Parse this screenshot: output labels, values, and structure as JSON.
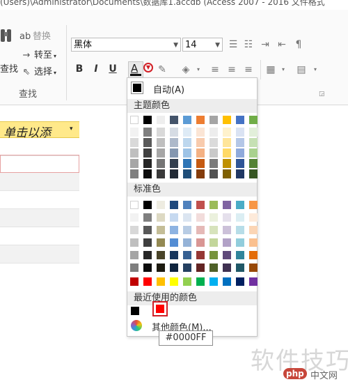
{
  "title_bar": {
    "text": "(Users)\\Administrator\\Documents\\数据库1.accdb (Access 2007 - 2016 文件格式"
  },
  "ribbon": {
    "find_group": {
      "find_label": "查找",
      "replace_label": "替换",
      "goto_label": "转至",
      "select_label": "选择",
      "group_label": "查找"
    },
    "text_format": {
      "font_name": "黑体",
      "font_size": "14",
      "bold": "B",
      "italic": "I",
      "underline": "U",
      "font_color_glyph": "A"
    }
  },
  "datasheet": {
    "column_header": "单击以添",
    "header_arrow": "▾"
  },
  "color_menu": {
    "automatic_label": "自动(A)",
    "theme_colors_label": "主题颜色",
    "standard_colors_label": "标准色",
    "recent_colors_label": "最近使用的颜色",
    "more_colors_label": "其他颜色(M)...",
    "tooltip_value": "#0000FF",
    "theme_base": [
      "#ffffff",
      "#000000",
      "#eeece1",
      "#1f497d",
      "#4f81bd",
      "#c0504d",
      "#f79646",
      "#9bbb59",
      "#4bacc6",
      "#8064a2"
    ],
    "theme_top": [
      "#ffffff",
      "#000000",
      "#eeeeee",
      "#44546a",
      "#5b9bd5",
      "#ed7d31",
      "#a5a5a5",
      "#ffc000",
      "#4472c4",
      "#70ad47"
    ],
    "theme_tints": [
      [
        "#f2f2f2",
        "#7f7f7f",
        "#d9d9d9",
        "#d6dce4",
        "#deebf6",
        "#fbe5d5",
        "#ededed",
        "#fff2cc",
        "#dae3f3",
        "#e2efda"
      ],
      [
        "#d9d9d9",
        "#595959",
        "#bfbfbf",
        "#adb9ca",
        "#bdd7ee",
        "#f8cbad",
        "#dbdbdb",
        "#ffe599",
        "#b4c7e7",
        "#c6e0b4"
      ],
      [
        "#bfbfbf",
        "#404040",
        "#a6a6a6",
        "#8497b0",
        "#9dc3e6",
        "#f4b183",
        "#c9c9c9",
        "#ffd966",
        "#8faadc",
        "#a9d18e"
      ],
      [
        "#a6a6a6",
        "#262626",
        "#757575",
        "#333f4f",
        "#2e75b6",
        "#c55a11",
        "#7b7b7b",
        "#bf9000",
        "#2f5597",
        "#548235"
      ],
      [
        "#7f7f7f",
        "#0d0d0d",
        "#3a3a3a",
        "#222a35",
        "#1f4e79",
        "#843c0c",
        "#525252",
        "#7f6000",
        "#203864",
        "#375623"
      ]
    ],
    "standard_top": [
      "#ffffff",
      "#000000",
      "#eeece1",
      "#1f497d",
      "#4f81bd",
      "#c0504d",
      "#9bbb59",
      "#8064a2",
      "#4bacc6",
      "#f79646"
    ],
    "standard_tints": [
      [
        "#f2f2f2",
        "#7f7f7f",
        "#ddd9c3",
        "#c6d9f0",
        "#dbe5f1",
        "#f2dcdb",
        "#ebf1dd",
        "#e5e0ec",
        "#dbeef3",
        "#fdeada"
      ],
      [
        "#d8d8d8",
        "#595959",
        "#c4bd97",
        "#8db3e2",
        "#b8cce4",
        "#e5b9b7",
        "#d7e3bc",
        "#ccc1d9",
        "#b7dde8",
        "#fbd5b5"
      ],
      [
        "#bfbfbf",
        "#3f3f3f",
        "#938953",
        "#548dd4",
        "#95b3d7",
        "#d99694",
        "#c3d69b",
        "#b2a2c7",
        "#92cddc",
        "#fac08f"
      ],
      [
        "#a5a5a5",
        "#262626",
        "#494429",
        "#17365d",
        "#366092",
        "#953734",
        "#76923c",
        "#5f497a",
        "#31859b",
        "#e36c09"
      ],
      [
        "#7f7f7f",
        "#0c0c0c",
        "#1d1b10",
        "#0f243e",
        "#244061",
        "#632423",
        "#4f6128",
        "#3f3151",
        "#205867",
        "#974806"
      ]
    ],
    "standard_bright": [
      "#c00000",
      "#ff0000",
      "#ffc000",
      "#ffff00",
      "#92d050",
      "#00b050",
      "#00b0f0",
      "#0070c0",
      "#002060",
      "#7030a0"
    ],
    "recent": [
      "#000000",
      "#ff0000"
    ]
  },
  "watermark": {
    "text": "软件技巧",
    "logo": "php",
    "site": "中文网"
  }
}
